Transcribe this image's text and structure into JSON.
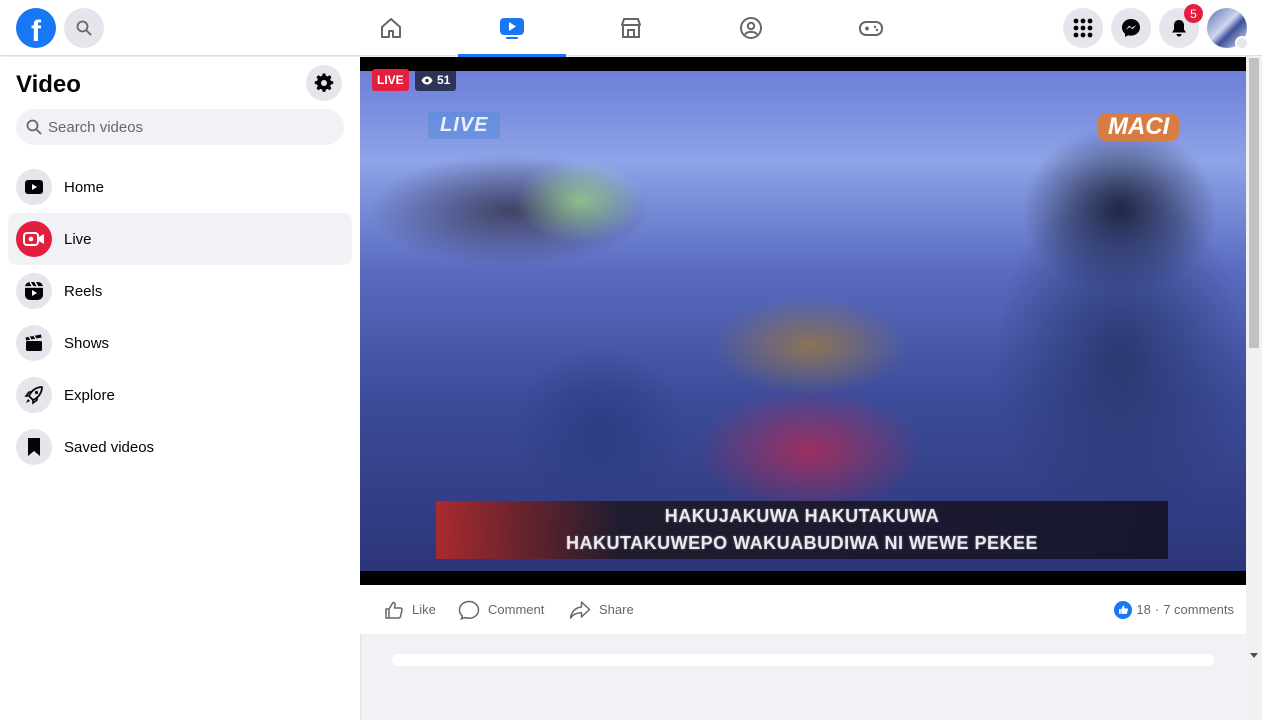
{
  "topbar": {
    "logo_letter": "f",
    "notification_count": "5",
    "nav_tabs": [
      "home-icon",
      "watch-icon",
      "marketplace-icon",
      "groups-icon",
      "gaming-icon"
    ],
    "active_tab": "watch-icon"
  },
  "sidebar": {
    "title": "Video",
    "search_placeholder": "Search videos",
    "items": [
      {
        "label": "Home",
        "icon": "video-home-icon"
      },
      {
        "label": "Live",
        "icon": "live-icon"
      },
      {
        "label": "Reels",
        "icon": "reels-icon"
      },
      {
        "label": "Shows",
        "icon": "shows-icon"
      },
      {
        "label": "Explore",
        "icon": "explore-icon"
      },
      {
        "label": "Saved videos",
        "icon": "saved-icon"
      }
    ],
    "active_item": "Live"
  },
  "video": {
    "live_badge": "LIVE",
    "viewer_count": "51",
    "tv_live_label": "LIVE",
    "channel_logo": "MACI",
    "caption_line1": "HAKUJAKUWA HAKUTAKUWA",
    "caption_line2": "HAKUTAKUWEPO WAKUABUDIWA NI WEWE PEKEE"
  },
  "actions": {
    "like_label": "Like",
    "comment_label": "Comment",
    "share_label": "Share",
    "like_count": "18",
    "separator": "·",
    "comments_count": "7 comments"
  },
  "colors": {
    "brand_blue": "#1877f2",
    "live_red": "#e41e3f"
  }
}
